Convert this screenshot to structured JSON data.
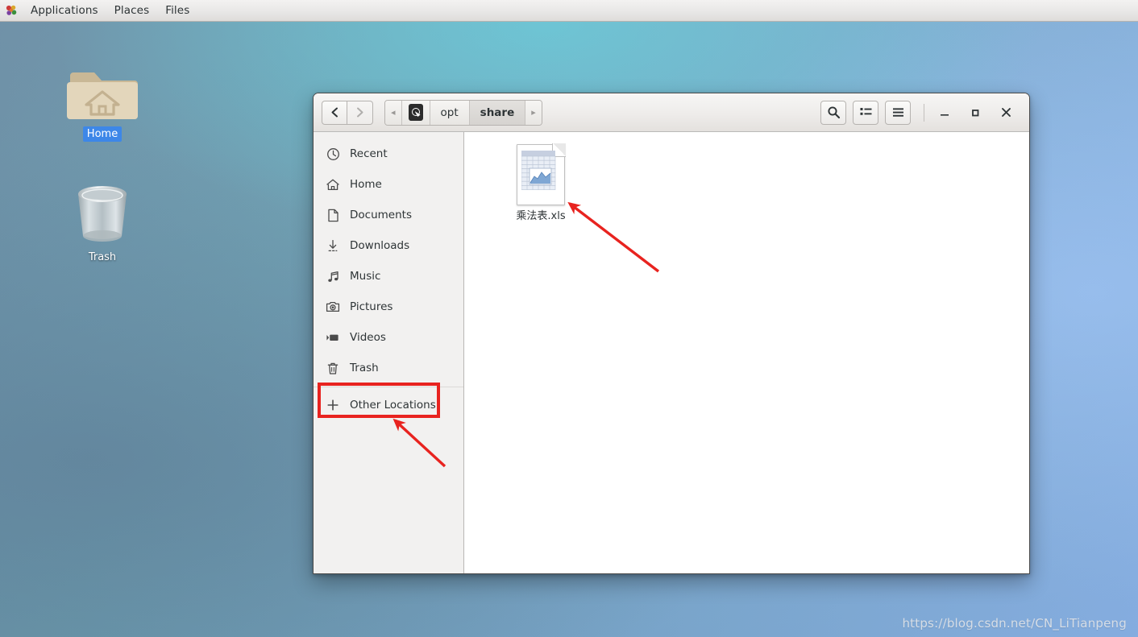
{
  "desktop": {
    "top_panel": {
      "logo_icon": "gnome-footprint-icon",
      "menus": [
        {
          "label": "Applications"
        },
        {
          "label": "Places"
        },
        {
          "label": "Files"
        }
      ]
    },
    "icons": [
      {
        "label": "Home",
        "icon": "home-folder-icon",
        "selected": true
      },
      {
        "label": "Trash",
        "icon": "trash-can-icon",
        "selected": false
      }
    ],
    "watermark": "https://blog.csdn.net/CN_LiTianpeng",
    "wallpaper_colors": {
      "left": "#6d90a8",
      "top_center": "#5aa9bd",
      "right": "#83aee4"
    }
  },
  "window": {
    "headerbar": {
      "back_button": {
        "icon": "chevron-left-icon",
        "enabled": true
      },
      "forward_button": {
        "icon": "chevron-right-icon",
        "enabled": false
      },
      "breadcrumb": {
        "left_arrow": "◂",
        "right_arrow": "▸",
        "root_icon": "hard-disk-icon",
        "crumbs": [
          {
            "label": "opt",
            "current": false
          },
          {
            "label": "share",
            "current": true
          }
        ]
      },
      "actions": [
        {
          "name": "search-button",
          "icon": "search-icon"
        },
        {
          "name": "view-list-button",
          "icon": "list-view-icon"
        },
        {
          "name": "menu-button",
          "icon": "hamburger-menu-icon"
        }
      ],
      "window_controls": {
        "minimize": "–",
        "maximize": "□",
        "close": "×"
      }
    },
    "sidebar": {
      "items": [
        {
          "label": "Recent",
          "icon": "clock-icon"
        },
        {
          "label": "Home",
          "icon": "home-icon"
        },
        {
          "label": "Documents",
          "icon": "document-icon"
        },
        {
          "label": "Downloads",
          "icon": "download-icon"
        },
        {
          "label": "Music",
          "icon": "music-note-icon"
        },
        {
          "label": "Pictures",
          "icon": "camera-icon"
        },
        {
          "label": "Videos",
          "icon": "video-icon"
        },
        {
          "label": "Trash",
          "icon": "trash-icon"
        }
      ],
      "other_locations": {
        "label": "Other Locations",
        "icon": "plus-icon",
        "highlighted": true
      }
    },
    "content": {
      "files": [
        {
          "name": "乘法表.xls",
          "icon": "spreadsheet-file-icon"
        }
      ]
    }
  },
  "annotations": {
    "highlight_color": "#e8231f",
    "box": {
      "target": "other-locations-row"
    },
    "arrows": [
      {
        "points_to": "spreadsheet-file-icon"
      },
      {
        "points_to": "other-locations-row"
      }
    ]
  }
}
